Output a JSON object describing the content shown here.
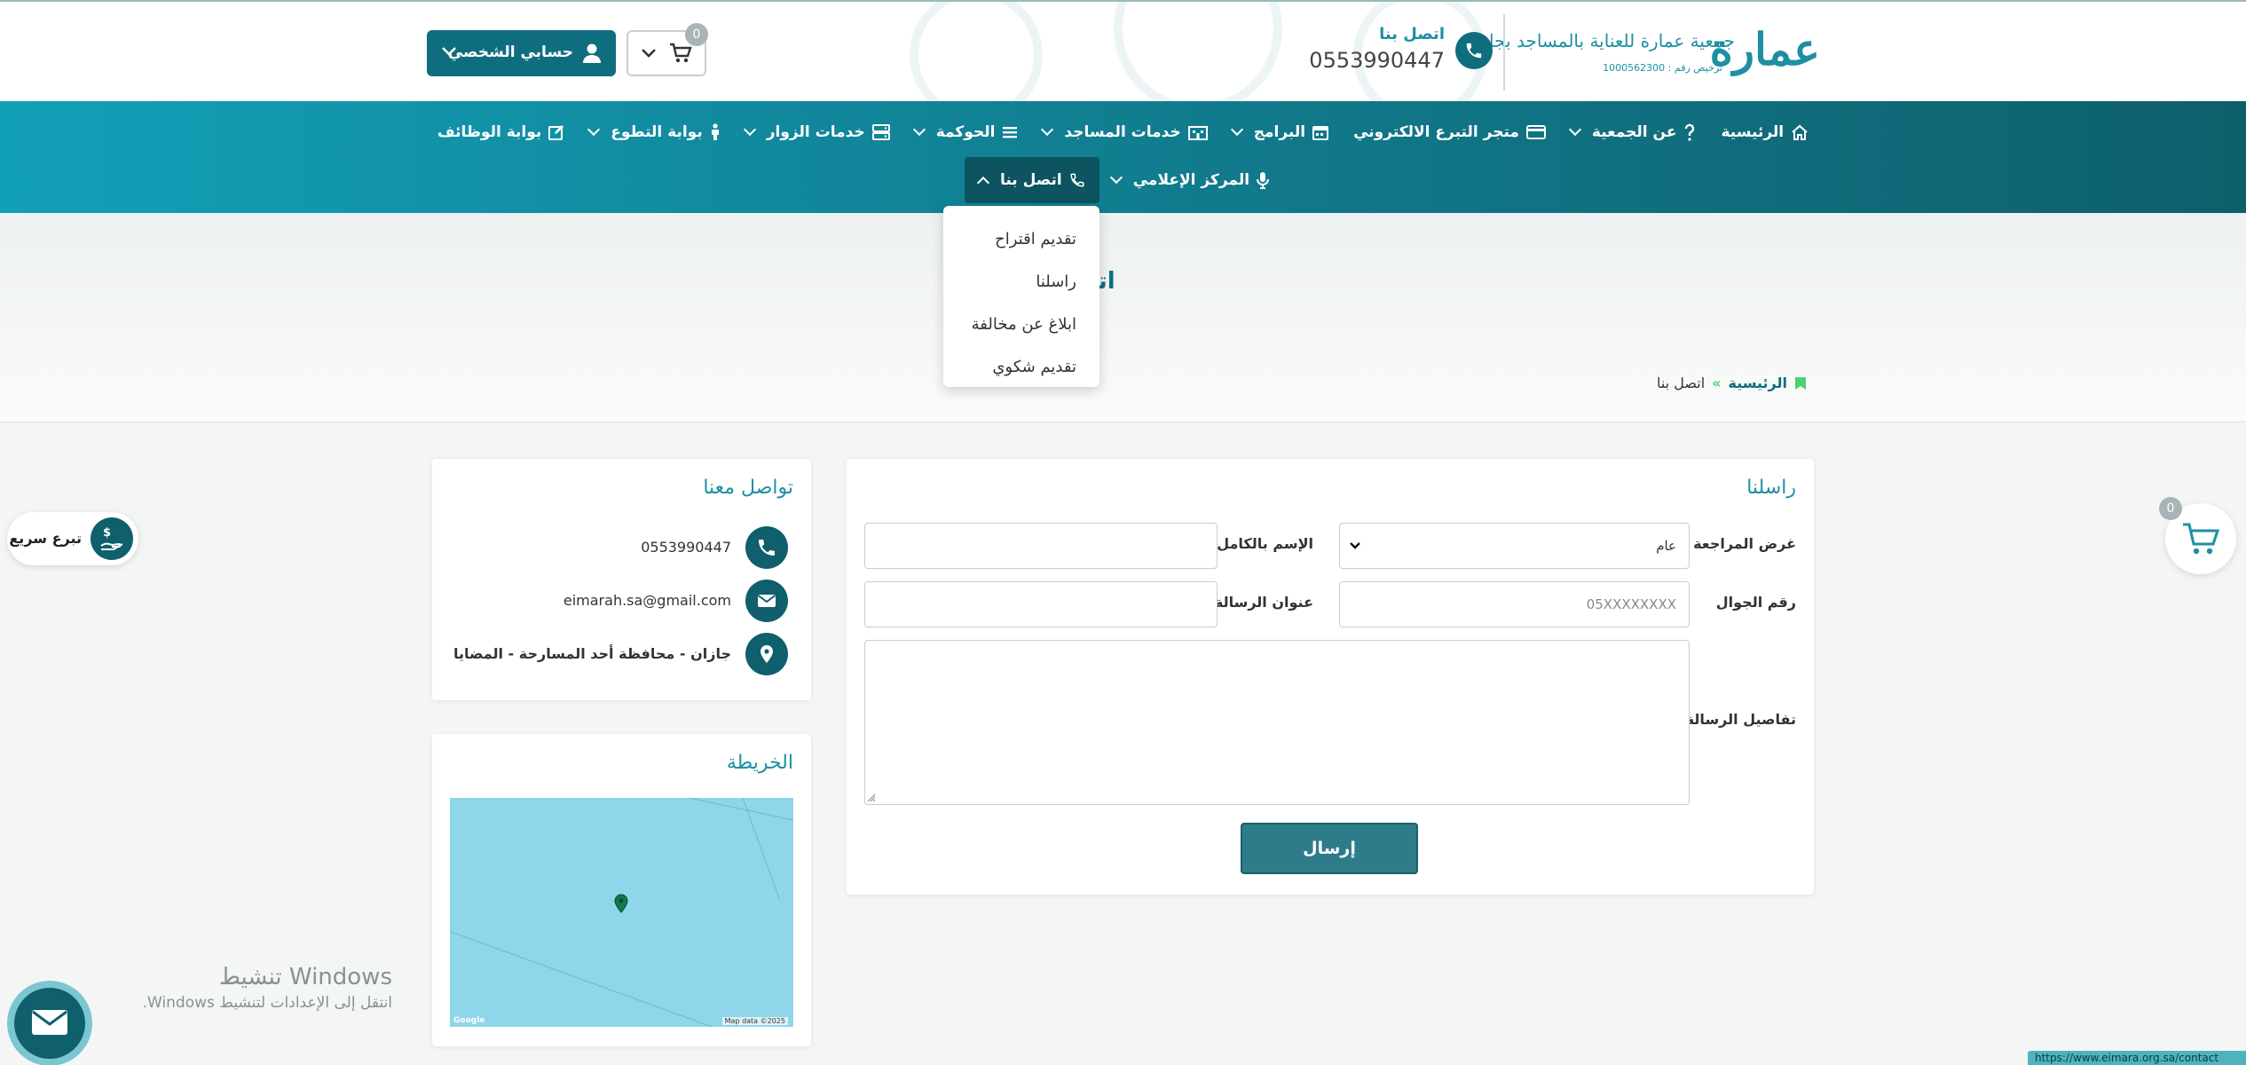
{
  "header": {
    "logo_main": "عمارة",
    "logo_subtitle": "جمعية عمارة للعناية بالمساجد بجازان",
    "logo_license": "ترخيص رقم : 1000562300",
    "contact_label": "اتصل بنا",
    "contact_phone": "0553990447",
    "cart_count": "0",
    "account_label": "حسابي الشخصي"
  },
  "nav": {
    "row1": [
      {
        "label": "الرئيسية",
        "icon": "home-icon",
        "has_caret": false
      },
      {
        "label": "عن الجمعية",
        "icon": "question-icon",
        "has_caret": true
      },
      {
        "label": "متجر التبرع الالكتروني",
        "icon": "card-icon",
        "has_caret": false
      },
      {
        "label": "البرامج",
        "icon": "calendar-icon",
        "has_caret": true
      },
      {
        "label": "خدمات المساجد",
        "icon": "building-icon",
        "has_caret": true
      },
      {
        "label": "الحوكمة",
        "icon": "list-icon",
        "has_caret": true
      },
      {
        "label": "خدمات الزوار",
        "icon": "server-icon",
        "has_caret": true
      },
      {
        "label": "بوابة التطوع",
        "icon": "person-icon",
        "has_caret": true
      },
      {
        "label": "بوابة الوظائف",
        "icon": "edit-icon",
        "has_caret": false
      }
    ],
    "row2": [
      {
        "label": "المركز الإعلامي",
        "icon": "microphone-icon",
        "has_caret": true
      },
      {
        "label": "اتصل بنا",
        "icon": "phone-icon",
        "has_caret": true,
        "active": true
      }
    ]
  },
  "dropdown": {
    "items": [
      "تقديم اقتراح",
      "راسلنا",
      "ابلاغ عن مخالفة",
      "تقديم شكوي"
    ]
  },
  "banner": {
    "title": "اتصل بنا",
    "breadcrumb_home": "الرئيسية",
    "breadcrumb_sep": "»",
    "breadcrumb_current": "اتصل بنا"
  },
  "form": {
    "title": "راسلنا",
    "purpose_label": "غرض المراجعة",
    "purpose_value": "عام",
    "name_label": "الإسم بالكامل",
    "name_value": "",
    "mobile_label": "رقم الجوال",
    "mobile_placeholder": "05XXXXXXXX",
    "subject_label": "عنوان الرسالة",
    "subject_value": "",
    "details_label": "تفاصيل الرسالة",
    "submit_label": "إرسال"
  },
  "contact": {
    "title": "تواصل معنا",
    "phone": "0553990447",
    "email": "eimarah.sa@gmail.com",
    "address": "جازان - محافظة أحد المسارحة - المضايا"
  },
  "map": {
    "title": "الخريطة",
    "credit": "Map data ©2025",
    "logo": "Google"
  },
  "widgets": {
    "quick_donate_label": "تبرع سريع",
    "float_cart_count": "0"
  },
  "os": {
    "activate_title": "تنشيط Windows",
    "activate_sub": "انتقل إلى الإعدادات لتنشيط Windows.",
    "status_url": "https://www.eimara.org.sa/contact"
  },
  "colors": {
    "primary": "#0f6e7e",
    "accent": "#1e8fa3",
    "nav_gradient_start": "#12a0b8",
    "nav_gradient_end": "#0e5f6c",
    "breadcrumb_marker": "#4bd36b"
  }
}
